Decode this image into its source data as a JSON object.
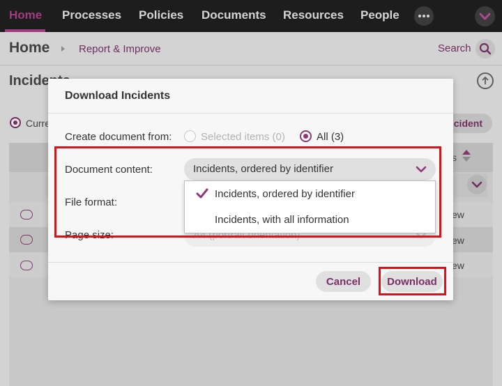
{
  "topnav": {
    "items": [
      {
        "label": "Home",
        "active": true
      },
      {
        "label": "Processes"
      },
      {
        "label": "Policies"
      },
      {
        "label": "Documents"
      },
      {
        "label": "Resources"
      },
      {
        "label": "People"
      }
    ],
    "more_icon": "ellipsis-icon",
    "profile_icon": "chevron-down-icon"
  },
  "breadcrumb": {
    "home": "Home",
    "current": "Report & Improve",
    "search_label": "Search"
  },
  "page": {
    "title": "Incidents",
    "radio_label": "Current",
    "add_button_label": "Incident",
    "column_tail": "s",
    "rows": [
      {
        "tail": "ew"
      },
      {
        "tail": "ew"
      },
      {
        "tail": "ew"
      }
    ]
  },
  "dialog": {
    "title": "Download Incidents",
    "create_from_label": "Create document from:",
    "option_selected": "Selected items (0)",
    "option_all": "All (3)",
    "document_content_label": "Document content:",
    "document_content_value": "Incidents, ordered by identifier",
    "file_format_label": "File format:",
    "page_size_label": "Page size:",
    "page_size_value": "A4 (portrait orientation)",
    "cancel_label": "Cancel",
    "download_label": "Download"
  },
  "dropdown": {
    "options": [
      {
        "label": "Incidents, ordered by identifier",
        "selected": true
      },
      {
        "label": "Incidents, with all information",
        "selected": false
      }
    ]
  },
  "colors": {
    "accent": "#8e3878",
    "nav_bg": "#1c1c1c",
    "highlight": "#d8141b"
  }
}
